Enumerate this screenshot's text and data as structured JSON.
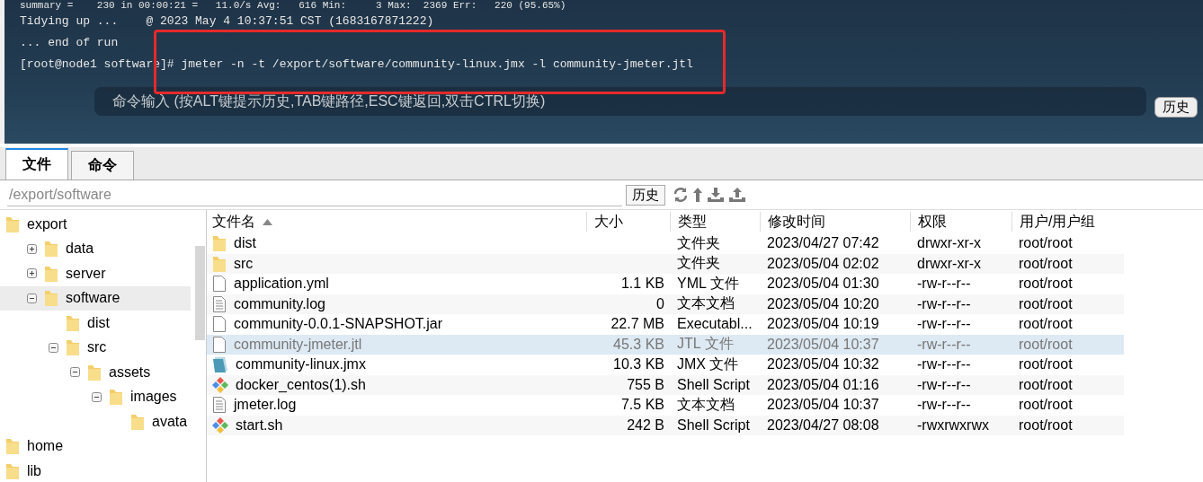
{
  "terminal": {
    "lines": [
      "summary =    230 in 00:00:21 =   11.0/s Avg:   616 Min:     3 Max:  2369 Err:   220 (95.65%)",
      "Tidying up ...    @ 2023 May 4 10:37:51 CST (1683167871222)",
      "... end of run",
      "[root@node1 software]# jmeter -n -t /export/software/community-linux.jmx -l community-jmeter.jtl"
    ],
    "command_placeholder": "命令输入 (按ALT键提示历史,TAB键路径,ESC键返回,双击CTRL切换)",
    "history_button": "历史"
  },
  "tabs": [
    {
      "label": "文件",
      "selected": true
    },
    {
      "label": "命令",
      "selected": false
    }
  ],
  "path": {
    "value": "/export/software",
    "history_button": "历史"
  },
  "tree": [
    {
      "name": "export",
      "selected": false,
      "children": [
        {
          "name": "data",
          "expanded": false,
          "selected": false
        },
        {
          "name": "server",
          "expanded": false,
          "selected": false
        },
        {
          "name": "software",
          "expanded": true,
          "selected": true,
          "children": [
            {
              "name": "dist",
              "selected": false
            },
            {
              "name": "src",
              "expanded": true,
              "selected": false,
              "children": [
                {
                  "name": "assets",
                  "expanded": true,
                  "selected": false,
                  "children": [
                    {
                      "name": "images",
                      "expanded": true,
                      "selected": false,
                      "children": [
                        {
                          "name": "avata",
                          "selected": false
                        }
                      ]
                    }
                  ]
                }
              ]
            }
          ]
        }
      ]
    },
    {
      "name": "home",
      "selected": false
    },
    {
      "name": "lib",
      "selected": false
    }
  ],
  "table": {
    "columns": [
      "文件名",
      "大小",
      "类型",
      "修改时间",
      "权限",
      "用户/用户组"
    ],
    "rows": [
      {
        "kind": "folder",
        "name": "dist",
        "size": "",
        "type": "文件夹",
        "mtime": "2023/04/27 07:42",
        "perm": "drwxr-xr-x",
        "owner": "root/root",
        "selected": false
      },
      {
        "kind": "folder",
        "name": "src",
        "size": "",
        "type": "文件夹",
        "mtime": "2023/05/04 02:02",
        "perm": "drwxr-xr-x",
        "owner": "root/root",
        "selected": false
      },
      {
        "kind": "file",
        "name": "application.yml",
        "size": "1.1 KB",
        "type": "YML 文件",
        "mtime": "2023/05/04 01:30",
        "perm": "-rw-r--r--",
        "owner": "root/root",
        "selected": false
      },
      {
        "kind": "text",
        "name": "community.log",
        "size": "0",
        "type": "文本文档",
        "mtime": "2023/05/04 10:20",
        "perm": "-rw-r--r--",
        "owner": "root/root",
        "selected": false
      },
      {
        "kind": "file",
        "name": "community-0.0.1-SNAPSHOT.jar",
        "size": "22.7 MB",
        "type": "Executabl...",
        "mtime": "2023/05/04 10:19",
        "perm": "-rw-r--r--",
        "owner": "root/root",
        "selected": false
      },
      {
        "kind": "file",
        "name": "community-jmeter.jtl",
        "size": "45.3 KB",
        "type": "JTL 文件",
        "mtime": "2023/05/04 10:37",
        "perm": "-rw-r--r--",
        "owner": "root/root",
        "selected": true
      },
      {
        "kind": "jmx",
        "name": "community-linux.jmx",
        "size": "10.3 KB",
        "type": "JMX 文件",
        "mtime": "2023/05/04 10:32",
        "perm": "-rw-r--r--",
        "owner": "root/root",
        "selected": false
      },
      {
        "kind": "script",
        "name": "docker_centos(1).sh",
        "size": "755 B",
        "type": "Shell Script",
        "mtime": "2023/05/04 01:16",
        "perm": "-rw-r--r--",
        "owner": "root/root",
        "selected": false
      },
      {
        "kind": "text",
        "name": "jmeter.log",
        "size": "7.5 KB",
        "type": "文本文档",
        "mtime": "2023/05/04 10:37",
        "perm": "-rw-r--r--",
        "owner": "root/root",
        "selected": false
      },
      {
        "kind": "script",
        "name": "start.sh",
        "size": "242 B",
        "type": "Shell Script",
        "mtime": "2023/04/27 08:08",
        "perm": "-rwxrwxrwx",
        "owner": "root/root",
        "selected": false
      }
    ]
  }
}
